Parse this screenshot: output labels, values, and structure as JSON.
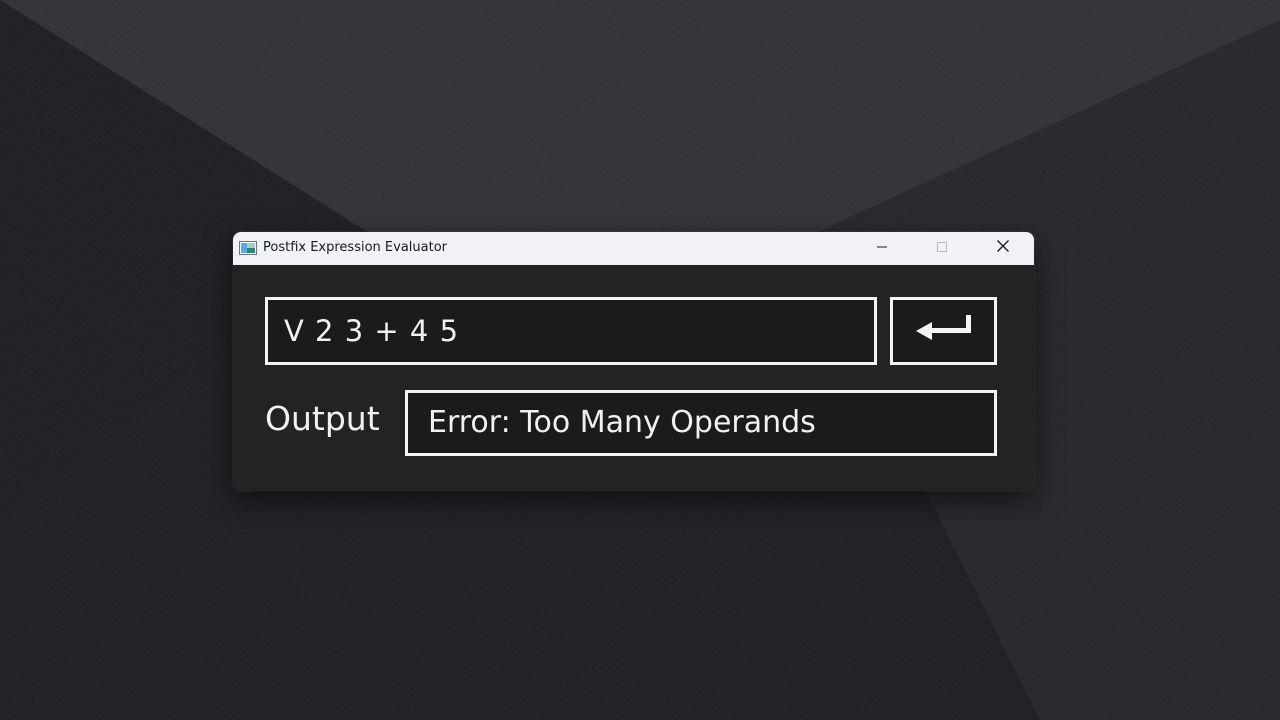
{
  "window": {
    "title": "Postfix Expression Evaluator",
    "app_icon": "app-window-icon",
    "controls": {
      "minimize_icon": "minimize-icon",
      "maximize_icon": "maximize-icon",
      "close_icon": "close-icon"
    }
  },
  "expression": {
    "value": "V 2 3 + 4 5",
    "placeholder": ""
  },
  "enter_button": {
    "icon": "enter-return-arrow-icon"
  },
  "output": {
    "label": "Output",
    "value": "Error: Too Many Operands"
  },
  "colors": {
    "titlebar": "#f1f2f5",
    "window_background": "#232323",
    "field_background": "#1b1b1b",
    "field_border": "#f4f4f4",
    "text": "#f1f1f1",
    "desktop": "#1c1d21"
  }
}
